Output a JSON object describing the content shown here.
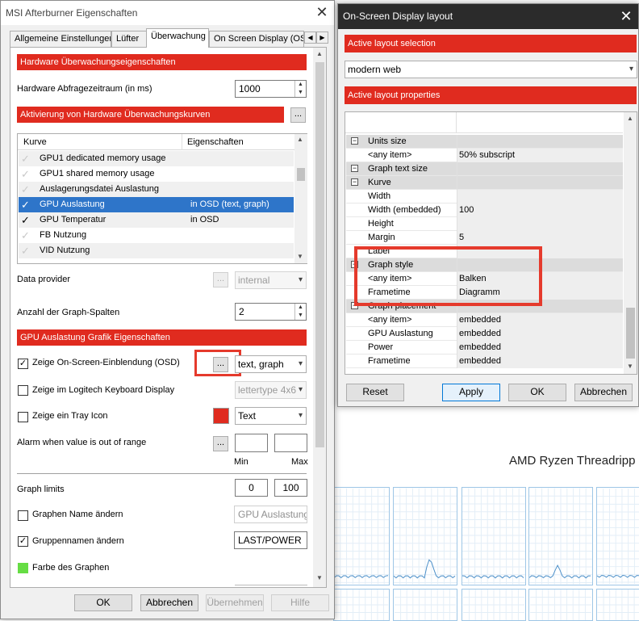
{
  "background": {
    "title": "AMD Ryzen Threadripp"
  },
  "ab_window": {
    "title": "MSI Afterburner Eigenschaften",
    "tabs": [
      "Allgemeine Einstellungen",
      "Lüfter",
      "Überwachung",
      "On Screen Display (OS"
    ],
    "section_hw": "Hardware Überwachungseigenschaften",
    "poll_label": "Hardware Abfragezeitraum (in ms)",
    "poll_value": "1000",
    "activation_label": "Aktivierung von Hardware Überwachungskurven",
    "dots": "...",
    "list_headers": {
      "curve": "Kurve",
      "props": "Eigenschaften"
    },
    "list_rows": [
      {
        "name": "GPU1 dedicated memory usage",
        "props": "",
        "checked": false,
        "selected": false
      },
      {
        "name": "GPU1 shared memory usage",
        "props": "",
        "checked": false,
        "selected": false
      },
      {
        "name": "Auslagerungsdatei Auslastung",
        "props": "",
        "checked": false,
        "selected": false
      },
      {
        "name": "GPU Auslastung",
        "props": "in OSD (text, graph)",
        "checked": true,
        "selected": true
      },
      {
        "name": "GPU Temperatur",
        "props": "in OSD",
        "checked": true,
        "selected": false
      },
      {
        "name": "FB Nutzung",
        "props": "",
        "checked": false,
        "selected": false
      },
      {
        "name": "VID Nutzung",
        "props": "",
        "checked": false,
        "selected": false
      }
    ],
    "data_provider_label": "Data provider",
    "data_provider_value": "internal",
    "graph_columns_label": "Anzahl der Graph-Spalten",
    "graph_columns_value": "2",
    "section_gpu": "GPU Auslastung Grafik Eigenschaften",
    "osd_label": "Zeige On-Screen-Einblendung (OSD)",
    "osd_mode": "text, graph",
    "logitech_label": "Zeige im Logitech Keyboard Display",
    "logitech_value": "lettertype 4x6",
    "tray_label": "Zeige ein Tray Icon",
    "tray_value": "Text",
    "tray_color": "#e02b1f",
    "alarm_label": "Alarm when value is out of range",
    "min_label": "Min",
    "max_label": "Max",
    "graph_limits_label": "Graph limits",
    "graph_limit_min": "0",
    "graph_limit_max": "100",
    "rename_graph_label": "Graphen Name ändern",
    "rename_graph_value": "GPU Auslastung",
    "group_name_label": "Gruppennamen ändern",
    "group_name_value": "LAST/POWER",
    "graph_color_label": "Farbe des Graphen",
    "graph_color": "#66dd44",
    "buttons": {
      "ok": "OK",
      "cancel": "Abbrechen",
      "apply": "Übernehmen",
      "help": "Hilfe"
    }
  },
  "osd_window": {
    "title": "On-Screen Display layout",
    "active_layout_selection": "Active layout selection",
    "layout_value": "modern web",
    "active_layout_properties": "Active layout properties",
    "rows": [
      {
        "name": "Units size",
        "value": "",
        "group": true
      },
      {
        "name": "<any item>",
        "value": "50% subscript",
        "group": false
      },
      {
        "name": "Graph text size",
        "value": "",
        "group": true
      },
      {
        "name": "Kurve",
        "value": "",
        "group": true
      },
      {
        "name": "Width",
        "value": "",
        "group": false
      },
      {
        "name": "Width (embedded)",
        "value": "100",
        "group": false
      },
      {
        "name": "Height",
        "value": "",
        "group": false
      },
      {
        "name": "Margin",
        "value": "5",
        "group": false
      },
      {
        "name": "Label",
        "value": "",
        "group": false
      },
      {
        "name": "Graph style",
        "value": "",
        "group": true
      },
      {
        "name": "<any item>",
        "value": "Balken",
        "group": false
      },
      {
        "name": "Frametime",
        "value": "Diagramm",
        "group": false
      },
      {
        "name": "Graph placement",
        "value": "",
        "group": true
      },
      {
        "name": "<any item>",
        "value": "embedded",
        "group": false
      },
      {
        "name": "GPU Auslastung",
        "value": "embedded",
        "group": false
      },
      {
        "name": "Power",
        "value": "embedded",
        "group": false
      },
      {
        "name": "Frametime",
        "value": "embedded",
        "group": false
      }
    ],
    "buttons": {
      "reset": "Reset",
      "apply": "Apply",
      "ok": "OK",
      "cancel": "Abbrechen"
    },
    "highlight_color": "#e53a2c"
  }
}
